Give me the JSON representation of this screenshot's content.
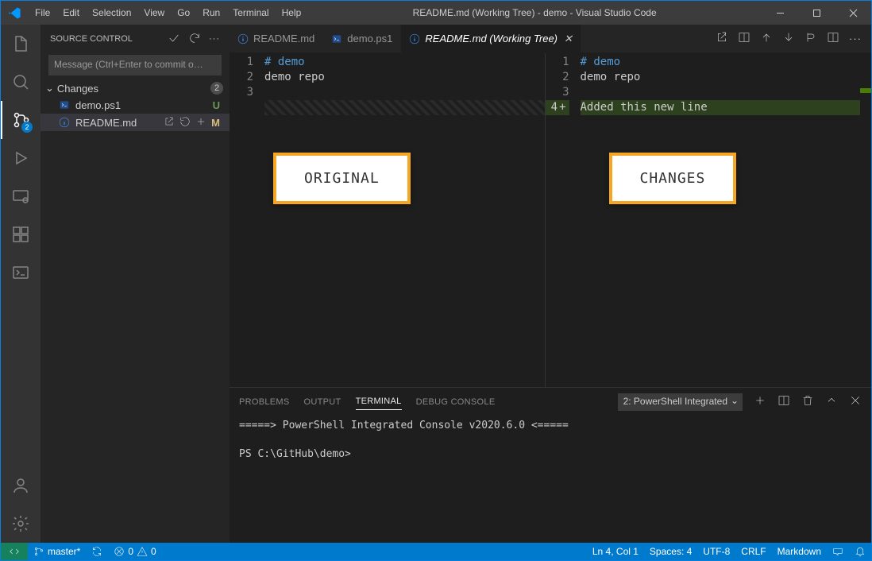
{
  "window": {
    "title": "README.md (Working Tree) - demo - Visual Studio Code"
  },
  "menu": {
    "items": [
      "File",
      "Edit",
      "Selection",
      "View",
      "Go",
      "Run",
      "Terminal",
      "Help"
    ]
  },
  "activitybar": {
    "source_control_badge": "2"
  },
  "sidebar": {
    "title": "SOURCE CONTROL",
    "commit_placeholder": "Message (Ctrl+Enter to commit o…",
    "section": "Changes",
    "section_count": "2",
    "files": [
      {
        "name": "demo.ps1",
        "status": "U"
      },
      {
        "name": "README.md",
        "status": "M"
      }
    ]
  },
  "tabs": {
    "items": [
      {
        "label": "README.md"
      },
      {
        "label": "demo.ps1"
      },
      {
        "label": "README.md (Working Tree)"
      }
    ]
  },
  "diff": {
    "original": {
      "lines": [
        {
          "num": "1",
          "text": "# demo",
          "cls": "hlcomment"
        },
        {
          "num": "2",
          "text": "demo repo",
          "cls": ""
        },
        {
          "num": "3",
          "text": "",
          "cls": ""
        }
      ]
    },
    "changed": {
      "lines": [
        {
          "num": "1",
          "text": "# demo",
          "cls": "hlcomment"
        },
        {
          "num": "2",
          "text": "demo repo",
          "cls": ""
        },
        {
          "num": "3",
          "text": "",
          "cls": ""
        }
      ],
      "added": {
        "num": "4",
        "plus": "+",
        "text": "Added this new line"
      }
    }
  },
  "annotations": {
    "left": "ORIGINAL",
    "right": "CHANGES"
  },
  "panel": {
    "tabs": [
      "PROBLEMS",
      "OUTPUT",
      "TERMINAL",
      "DEBUG CONSOLE"
    ],
    "active_tab": "TERMINAL",
    "terminal_selector": "2: PowerShell Integrated",
    "lines": [
      "=====> PowerShell Integrated Console v2020.6.0 <=====",
      "",
      "PS C:\\GitHub\\demo>"
    ]
  },
  "statusbar": {
    "branch": "master*",
    "errors": "0",
    "warnings": "0",
    "cursor": "Ln 4, Col 1",
    "spaces": "Spaces: 4",
    "encoding": "UTF-8",
    "eol": "CRLF",
    "language": "Markdown"
  }
}
